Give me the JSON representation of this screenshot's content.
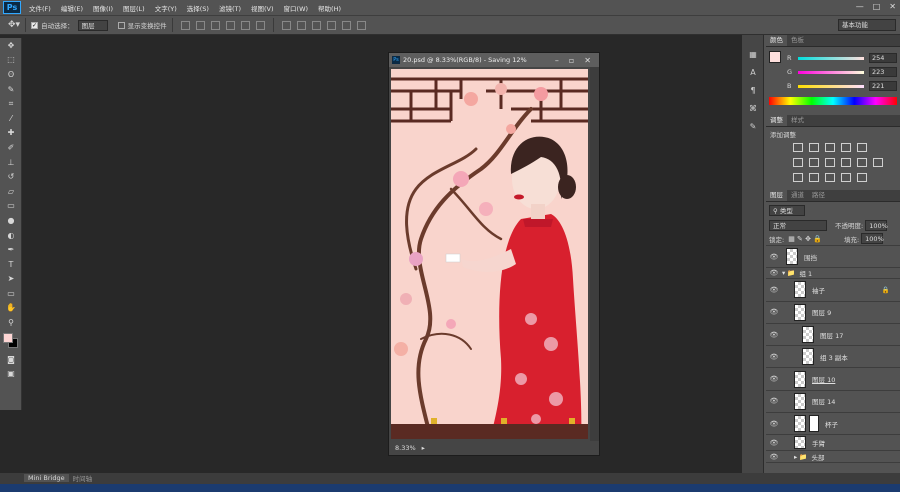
{
  "menubar": {
    "logo": "Ps",
    "items": [
      "文件(F)",
      "编辑(E)",
      "图像(I)",
      "图层(L)",
      "文字(Y)",
      "选择(S)",
      "滤镜(T)",
      "视图(V)",
      "窗口(W)",
      "帮助(H)"
    ],
    "window_controls": [
      "—",
      "□",
      "✕"
    ]
  },
  "options": {
    "auto_select_label": "自动选择：",
    "auto_select_value": "图层",
    "show_transform_label": "显示变换控件",
    "workspace": "基本功能"
  },
  "tools": [
    "move",
    "marquee",
    "lasso",
    "quick-select",
    "crop",
    "eyedropper",
    "healing",
    "brush",
    "stamp",
    "history-brush",
    "eraser",
    "gradient",
    "blur",
    "dodge",
    "pen",
    "type",
    "path-select",
    "shape",
    "hand",
    "zoom"
  ],
  "document": {
    "title": "20.psd @ 8.33%(RGB/8) - Saving 12%",
    "zoom": "8.33%",
    "colors": {
      "artboard": "#f9d4cc",
      "dress": "#d8202e"
    }
  },
  "color_panel": {
    "tabs": [
      "颜色",
      "色板"
    ],
    "r_label": "R",
    "r": "254",
    "g_label": "G",
    "g": "223",
    "b_label": "B",
    "b": "221"
  },
  "adjust_panel": {
    "tabs": [
      "调整",
      "样式"
    ],
    "title": "添加调整"
  },
  "layers_panel": {
    "tabs": [
      "图层",
      "通道",
      "路径"
    ],
    "filter": "类型",
    "blend_mode": "正常",
    "opacity_label": "不透明度:",
    "opacity": "100%",
    "lock_label": "锁定:",
    "fill_label": "填充:",
    "fill": "100%",
    "layers": [
      {
        "name": "围挡"
      },
      {
        "name": "组 1"
      },
      {
        "name": "袖子"
      },
      {
        "name": "图层 9"
      },
      {
        "name": "图层 17"
      },
      {
        "name": "组 3 副本"
      },
      {
        "name": "图层 10"
      },
      {
        "name": "图层 14"
      },
      {
        "name": "杯子"
      },
      {
        "name": "手臂"
      },
      {
        "name": "头部"
      }
    ]
  },
  "bottom": {
    "tabs": [
      "Mini Bridge",
      "时间轴"
    ]
  }
}
